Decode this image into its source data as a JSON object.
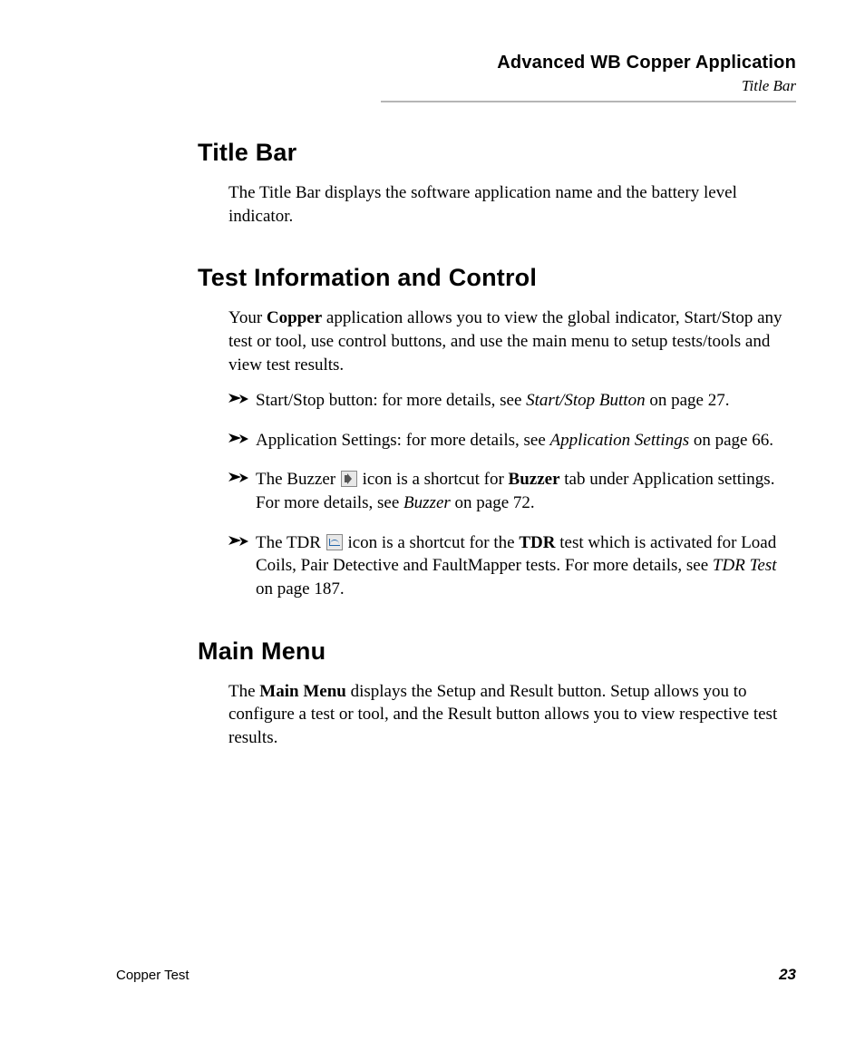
{
  "header": {
    "title": "Advanced WB Copper Application",
    "subtitle": "Title Bar"
  },
  "sections": {
    "titlebar": {
      "heading": "Title Bar",
      "para": "The Title Bar displays the software application name and the battery level indicator."
    },
    "testinfo": {
      "heading": "Test Information and Control",
      "intro_pre": "Your ",
      "intro_bold": "Copper",
      "intro_post": " application allows you to view the global indicator, Start/Stop any test or tool, use control buttons, and use the main menu to setup tests/tools and view test results.",
      "bullets": {
        "b1_pre": "Start/Stop button: for more details, see ",
        "b1_ital": "Start/Stop Button",
        "b1_post": " on page 27.",
        "b2_pre": "Application Settings: for more details, see ",
        "b2_ital": "Application Settings",
        "b2_post": " on page 66.",
        "b3_pre": "The Buzzer ",
        "b3_mid": " icon is a shortcut for ",
        "b3_bold": "Buzzer",
        "b3_mid2": " tab under Application settings. For more details, see ",
        "b3_ital": "Buzzer",
        "b3_post": " on page 72.",
        "b4_pre": "The TDR ",
        "b4_mid": " icon is a shortcut for the ",
        "b4_bold": "TDR",
        "b4_mid2": " test which is activated for Load Coils, Pair Detective and FaultMapper tests. For more details, see ",
        "b4_ital": "TDR Test",
        "b4_post": " on page 187."
      }
    },
    "mainmenu": {
      "heading": "Main Menu",
      "para_pre": "The ",
      "para_bold": "Main Menu",
      "para_post": " displays the Setup and Result button. Setup allows you to configure a test or tool, and the Result button allows you to view respective test results."
    }
  },
  "footer": {
    "doc": "Copper Test",
    "page": "23"
  }
}
